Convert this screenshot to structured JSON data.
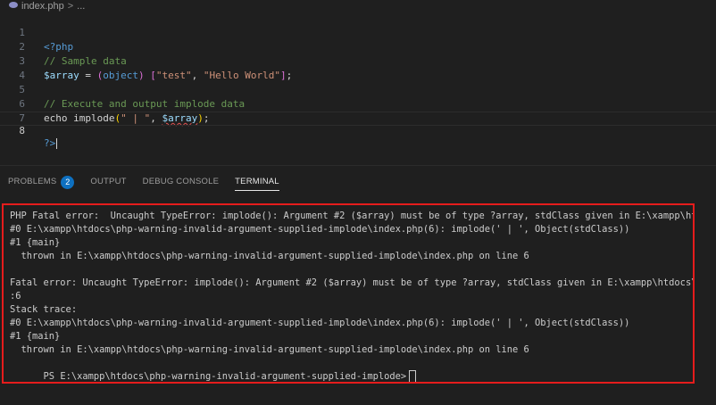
{
  "breadcrumb": {
    "file": "index.php",
    "separator": ">",
    "ellipsis": "..."
  },
  "editor": {
    "lines": [
      {
        "number": "1",
        "text": "<?php"
      },
      {
        "number": "2",
        "text": "// Sample data"
      },
      {
        "number": "3",
        "text": "$array = (object) [\"test\", \"Hello World\"];"
      },
      {
        "number": "4",
        "text": ""
      },
      {
        "number": "5",
        "text": "// Execute and output implode data"
      },
      {
        "number": "6",
        "text": "echo implode(\" | \", $array);"
      },
      {
        "number": "7",
        "text": ""
      },
      {
        "number": "8",
        "text": "?>"
      }
    ]
  },
  "panel": {
    "tabs": [
      {
        "label": "PROBLEMS",
        "badge": "2",
        "active": false
      },
      {
        "label": "OUTPUT",
        "active": false
      },
      {
        "label": "DEBUG CONSOLE",
        "active": false
      },
      {
        "label": "TERMINAL",
        "active": true
      }
    ]
  },
  "terminal": {
    "lines": [
      "PHP Fatal error:  Uncaught TypeError: implode(): Argument #2 ($array) must be of type ?array, stdClass given in E:\\xampp\\htdocs\\php-",
      "#0 E:\\xampp\\htdocs\\php-warning-invalid-argument-supplied-implode\\index.php(6): implode(' | ', Object(stdClass))",
      "#1 {main}",
      "  thrown in E:\\xampp\\htdocs\\php-warning-invalid-argument-supplied-implode\\index.php on line 6",
      "",
      "Fatal error: Uncaught TypeError: implode(): Argument #2 ($array) must be of type ?array, stdClass given in E:\\xampp\\htdocs\\php-warni",
      ":6",
      "Stack trace:",
      "#0 E:\\xampp\\htdocs\\php-warning-invalid-argument-supplied-implode\\index.php(6): implode(' | ', Object(stdClass))",
      "#1 {main}",
      "  thrown in E:\\xampp\\htdocs\\php-warning-invalid-argument-supplied-implode\\index.php on line 6"
    ],
    "prompt": "PS E:\\xampp\\htdocs\\php-warning-invalid-argument-supplied-implode>"
  },
  "colors": {
    "highlight_border": "#e51c1c",
    "badge": "#0e70c0"
  }
}
